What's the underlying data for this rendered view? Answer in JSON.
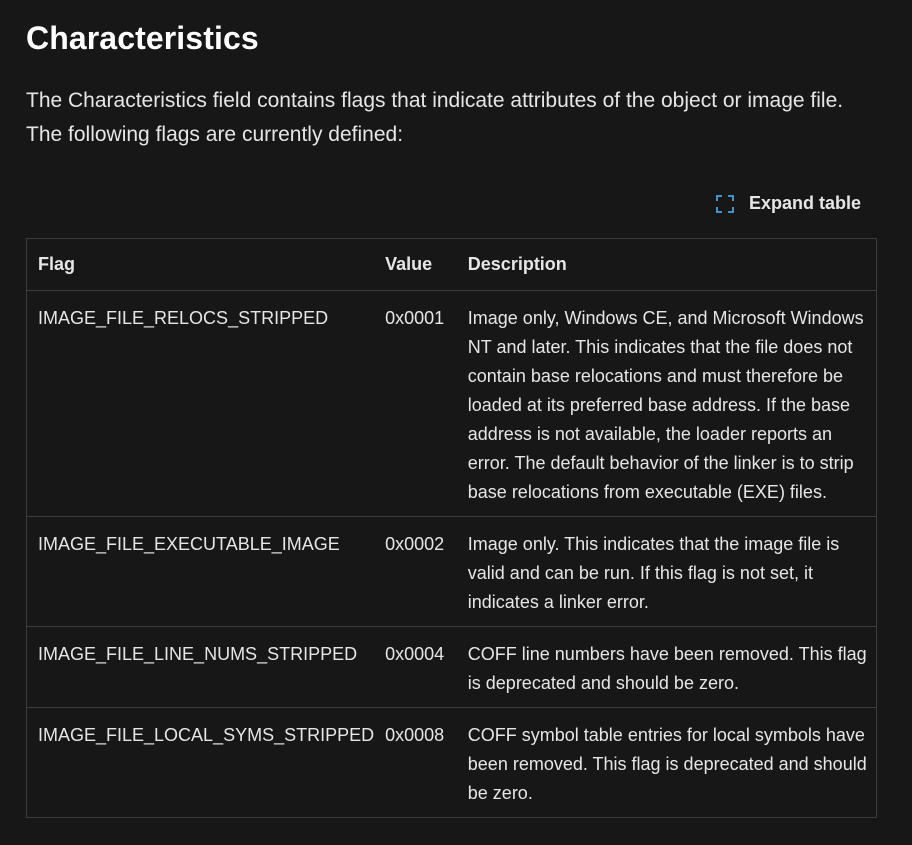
{
  "heading": "Characteristics",
  "intro": "The Characteristics field contains flags that indicate attributes of the object or image file. The following flags are currently defined:",
  "expand_table": {
    "label": "Expand table",
    "icon": "expand-icon"
  },
  "table": {
    "headers": {
      "flag": "Flag",
      "value": "Value",
      "description": "Description"
    },
    "rows": [
      {
        "flag": "IMAGE_FILE_RELOCS_STRIPPED",
        "value": "0x0001",
        "description": "Image only, Windows CE, and Microsoft Windows NT and later. This indicates that the file does not contain base relocations and must therefore be loaded at its preferred base address. If the base address is not available, the loader reports an error. The default behavior of the linker is to strip base relocations from executable (EXE) files."
      },
      {
        "flag": "IMAGE_FILE_EXECUTABLE_IMAGE",
        "value": "0x0002",
        "description": "Image only. This indicates that the image file is valid and can be run. If this flag is not set, it indicates a linker error."
      },
      {
        "flag": "IMAGE_FILE_LINE_NUMS_STRIPPED",
        "value": "0x0004",
        "description": "COFF line numbers have been removed. This flag is deprecated and should be zero."
      },
      {
        "flag": "IMAGE_FILE_LOCAL_SYMS_STRIPPED",
        "value": "0x0008",
        "description": "COFF symbol table entries for local symbols have been removed. This flag is deprecated and should be zero."
      }
    ]
  },
  "colors": {
    "background": "#171717",
    "text": "#e6e6e6",
    "border": "#3c3c3c"
  }
}
